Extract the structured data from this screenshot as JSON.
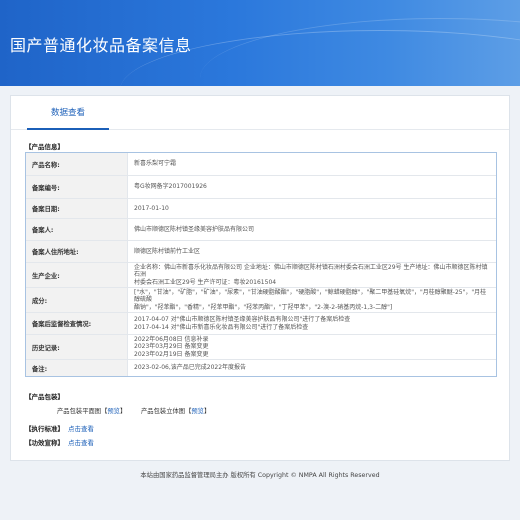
{
  "header": {
    "title": "国产普通化妆品备案信息"
  },
  "tabs": [
    {
      "label": "数据查看"
    }
  ],
  "product_section": {
    "title": "【产品信息】",
    "rows": [
      {
        "label": "产品名称:",
        "lines": [
          "新喜乐梨可宁霜"
        ]
      },
      {
        "label": "备案编号:",
        "lines": [
          "粤G妆网备字2017001926"
        ]
      },
      {
        "label": "备案日期:",
        "lines": [
          "2017-01-10"
        ]
      },
      {
        "label": "备案人:",
        "lines": [
          "佛山市顺德区陈村镇圣缘美容护肤品有限公司"
        ]
      },
      {
        "label": "备案人住所地址:",
        "lines": [
          "顺德区陈村镇前竹工业区"
        ]
      },
      {
        "label": "生产企业:",
        "lines": [
          "企业名称：佛山市新喜乐化妆品有限公司 企业地址：佛山市顺德区陈村镇石洲村委会石洲工业区29号 生产地址：佛山市顺德区陈村镇石洲",
          "村委会石洲工业区29号 生产许可证：粤妆20161504"
        ]
      },
      {
        "label": "成分:",
        "lines": [
          "[\"水\"，\"甘油\"，\"矿脂\"，\"矿油\"，\"尿素\"，\"甘油硬脂酸酯\"，\"硬脂酸\"，\"鲸蜡硬脂醇\"，\"聚二甲基硅氧烷\"，\"月桂醇聚醚-25\"，\"月桂醇硫酸",
          "酯钠\"，\"羟苯酯\"，\"香精\"，\"羟苯甲酯\"，\"羟苯丙酯\"，\"丁羟甲苯\"，\"2-溴-2-硝基丙烷-1,3-二醇\"]"
        ]
      },
      {
        "label": "备案后监督检查情况:",
        "lines": [
          "2017-04-07 对\"佛山市顺德区陈村镇圣缘美容护肤品有限公司\"进行了备案后检查",
          "2017-04-14 对\"佛山市新喜乐化妆品有限公司\"进行了备案后检查"
        ]
      },
      {
        "label": "历史记录:",
        "lines": [
          "2022年06月08日 信息补录",
          "2023年03月29日 备案变更",
          "2023年02月19日 备案变更"
        ]
      },
      {
        "label": "备注:",
        "lines": [
          "2023-02-06,该产品已完成2022年度报告"
        ]
      }
    ]
  },
  "package_section": {
    "title": "【产品包装】",
    "flat_label": "产品包装平面图",
    "stereo_label": "产品包装立体图",
    "preview_link": "预览"
  },
  "standard_section": {
    "title": "【执行标准】",
    "link": "点击查看"
  },
  "claim_section": {
    "title": "【功效宣称】",
    "link": "点击查看"
  },
  "footer": {
    "text": "本站由国家药品监督管理局主办 版权所有 Copyright © NMPA All Rights Reserved"
  }
}
